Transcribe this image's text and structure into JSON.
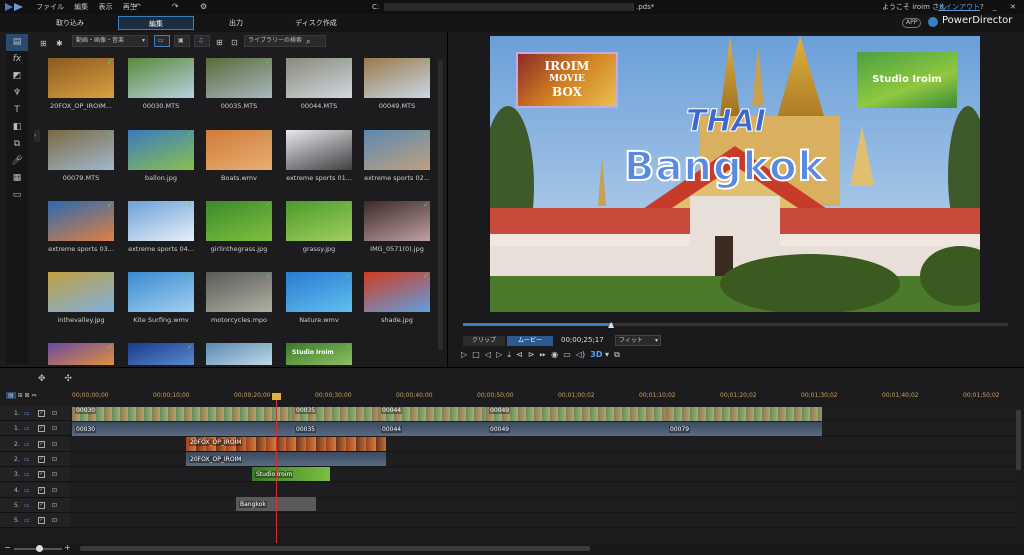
{
  "menu": [
    "ファイル",
    "編集",
    "表示",
    "再生"
  ],
  "file_title": ".pds*",
  "file_title_prefix": "C:",
  "welcome": "ようこそ iroim さん",
  "signout": "サインアウト",
  "app_badge": "APP",
  "app_name": "PowerDirector",
  "help": "?",
  "modes": [
    "取り込み",
    "編集",
    "出力",
    "ディスク作成"
  ],
  "library": {
    "filter": "動画・画像・音楽",
    "search_placeholder": "ライブラリーの検索",
    "items": [
      {
        "name": "20FOX_OP_IROIM...",
        "c1": "#8a5a20",
        "c2": "#d9a040"
      },
      {
        "name": "00030.MTS",
        "c1": "#5a8a3a",
        "c2": "#b8d0e0"
      },
      {
        "name": "00035.MTS",
        "c1": "#5a6a3a",
        "c2": "#a8b8c0"
      },
      {
        "name": "00044.MTS",
        "c1": "#8a8a7a",
        "c2": "#d0d8e0"
      },
      {
        "name": "00049.MTS",
        "c1": "#9a7a4a",
        "c2": "#c8d8e8"
      },
      {
        "name": "00079.MTS",
        "c1": "#7a6a40",
        "c2": "#a0b8d0"
      },
      {
        "name": "ballon.jpg",
        "c1": "#3a7ac0",
        "c2": "#8ac050"
      },
      {
        "name": "Boats.wmv",
        "c1": "#d07a3a",
        "c2": "#e8b070"
      },
      {
        "name": "extreme sports 01...",
        "c1": "#e8e8f0",
        "c2": "#404040"
      },
      {
        "name": "extreme sports 02...",
        "c1": "#5a8ab0",
        "c2": "#c0a080"
      },
      {
        "name": "extreme sports 03...",
        "c1": "#2a6ab0",
        "c2": "#e08040"
      },
      {
        "name": "extreme sports 04...",
        "c1": "#6aa0d8",
        "c2": "#e8f0f8"
      },
      {
        "name": "girlinthegrass.jpg",
        "c1": "#3a8a2a",
        "c2": "#80c040"
      },
      {
        "name": "grassy.jpg",
        "c1": "#4a9a2a",
        "c2": "#a0d060"
      },
      {
        "name": "IMG_0571(0).jpg",
        "c1": "#3a2a2a",
        "c2": "#c0a0a0"
      },
      {
        "name": "inthevalley.jpg",
        "c1": "#c0a040",
        "c2": "#80b0e0"
      },
      {
        "name": "Kite Surfing.wmv",
        "c1": "#3a8ad0",
        "c2": "#a0d0f0"
      },
      {
        "name": "motorcycles.mpo",
        "c1": "#5a5a5a",
        "c2": "#b0b0a0"
      },
      {
        "name": "Nature.wmv",
        "c1": "#2a7ad0",
        "c2": "#60c0f0"
      },
      {
        "name": "shade.jpg",
        "c1": "#d03a20",
        "c2": "#60a0e0"
      },
      {
        "name": "",
        "c1": "#6a4aa0",
        "c2": "#e09040"
      },
      {
        "name": "",
        "c1": "#1a3a8a",
        "c2": "#5a8ad0"
      },
      {
        "name": "",
        "c1": "#5a8ab0",
        "c2": "#c0d8e8"
      },
      {
        "name": "",
        "c1": "#3a7a2a",
        "c2": "#90c060",
        "label": "Studio Iroim"
      }
    ]
  },
  "preview": {
    "logo_left": [
      "IROIM",
      "MOVIE",
      "BOX"
    ],
    "logo_right": "Studio Iroim",
    "title1": "THAI",
    "title2": "Bangkok",
    "mode_clip": "クリップ",
    "mode_movie": "ムービー",
    "timecode": "00;00;25;17",
    "fit": "フィット",
    "stereo": "3D"
  },
  "timeline": {
    "ruler": [
      "00;00;00;00",
      "00;00;10;00",
      "00;00;20;00",
      "00;00;30;00",
      "00;00;40;00",
      "00;00;50;00",
      "00;01;00;02",
      "00;01;10;02",
      "00;01;20;02",
      "00;01;30;02",
      "00;01;40;02",
      "00;01;50;02"
    ],
    "tracks": [
      "1.",
      "1.",
      "2.",
      "2.",
      "3.",
      "4.",
      "5.",
      "5."
    ],
    "clip_labels": {
      "t1a": "00030",
      "t1b": "00035",
      "t1c": "00044",
      "t1d": "00049",
      "t1a_audio": "00030",
      "t1b_audio": "00035",
      "t1c_audio": "00044",
      "t1d_audio": "00049",
      "t1e_audio": "00079",
      "t2": "20FOX_OP_IROIM",
      "t2_audio": "20FOX_OP_IROIM",
      "t3": "Studio Iroim",
      "t4": "Bangkok"
    }
  },
  "colors": {
    "accent": "#3a7fc0",
    "playhead": "#d03030",
    "ruler_text": "#c9a05a"
  }
}
